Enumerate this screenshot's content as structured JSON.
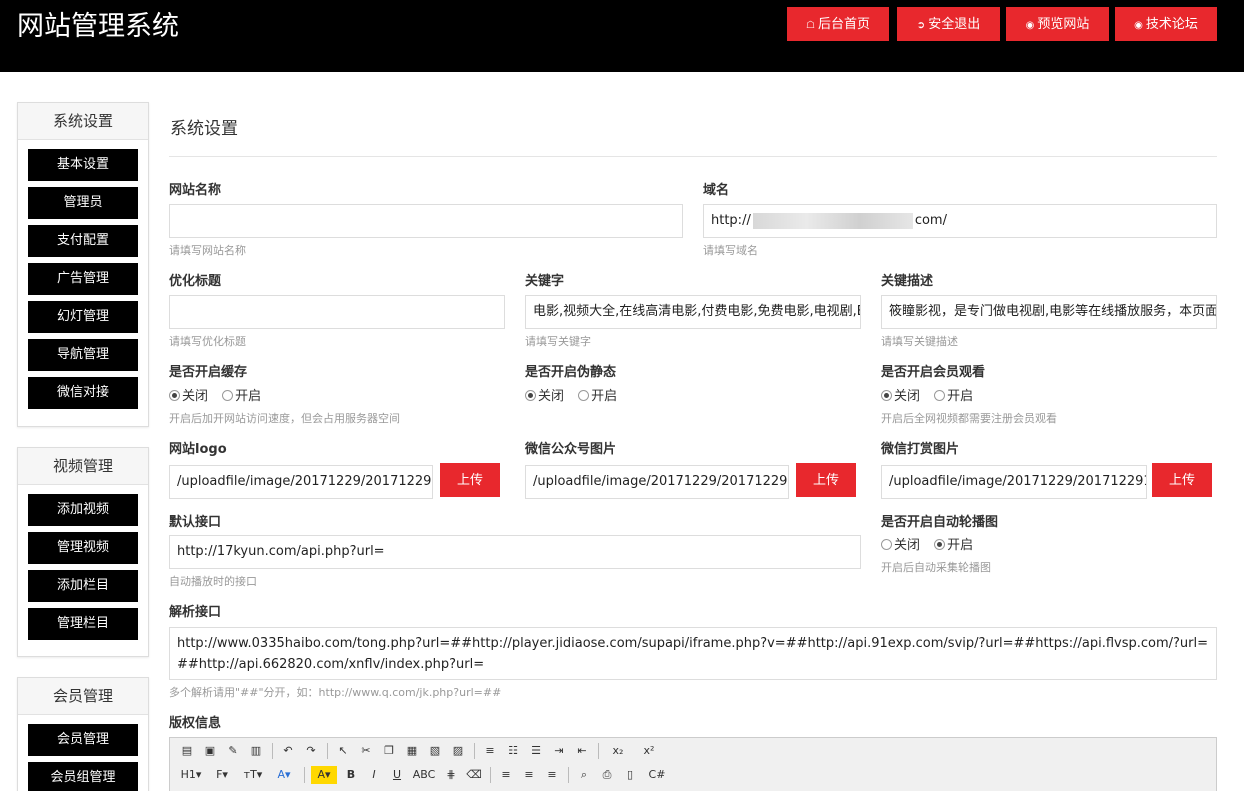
{
  "app": {
    "title": "网站管理系统"
  },
  "header": {
    "buttons": [
      {
        "label": "后台首页",
        "icon": "home-icon"
      },
      {
        "label": "安全退出",
        "icon": "logout-icon"
      },
      {
        "label": "预览网站",
        "icon": "eye-icon"
      },
      {
        "label": "技术论坛",
        "icon": "eye-icon"
      }
    ]
  },
  "sidebar": {
    "sections": [
      {
        "title": "系统设置",
        "items": [
          "基本设置",
          "管理员",
          "支付配置",
          "广告管理",
          "幻灯管理",
          "导航管理",
          "微信对接"
        ]
      },
      {
        "title": "视频管理",
        "items": [
          "添加视频",
          "管理视频",
          "添加栏目",
          "管理栏目"
        ]
      },
      {
        "title": "会员管理",
        "items": [
          "会员管理",
          "会员组管理"
        ]
      }
    ]
  },
  "main": {
    "title": "系统设置",
    "site_name": {
      "label": "网站名称",
      "value": "",
      "help": "请填写网站名称"
    },
    "domain": {
      "label": "域名",
      "prefix": "http://",
      "suffix": "com/",
      "help": "请填写域名"
    },
    "seo_title": {
      "label": "优化标题",
      "value": "",
      "help": "请填写优化标题"
    },
    "keywords": {
      "label": "关键字",
      "value": "电影,视频大全,在线高清电影,付费电影,免费电影,电视剧,E",
      "help": "请填写关键字"
    },
    "description": {
      "label": "关键描述",
      "value": "筱瞳影视，是专门做电视剧,电影等在线播放服务，本页面",
      "help": "请填写关键描述"
    },
    "cache": {
      "label": "是否开启缓存",
      "options": [
        "关闭",
        "开启"
      ],
      "selected": "关闭",
      "help": "开启后加开网站访问速度，但会占用服务器空间"
    },
    "rewrite": {
      "label": "是否开启伪静态",
      "options": [
        "关闭",
        "开启"
      ],
      "selected": "关闭"
    },
    "member_view": {
      "label": "是否开启会员观看",
      "options": [
        "关闭",
        "开启"
      ],
      "selected": "关闭",
      "help": "开启后全网视频都需要注册会员观看"
    },
    "logo": {
      "label": "网站logo",
      "value": "/uploadfile/image/20171229/201712291",
      "button": "上传"
    },
    "wechat_qr": {
      "label": "微信公众号图片",
      "value": "/uploadfile/image/20171229/201712291",
      "button": "上传"
    },
    "wechat_reward": {
      "label": "微信打赏图片",
      "value": "/uploadfile/image/20171229/201712291",
      "button": "上传"
    },
    "default_api": {
      "label": "默认接口",
      "value": "http://17kyun.com/api.php?url=",
      "help": "自动播放时的接口"
    },
    "carousel": {
      "label": "是否开启自动轮播图",
      "options": [
        "关闭",
        "开启"
      ],
      "selected": "开启",
      "help": "开启后自动采集轮播图"
    },
    "parse_api": {
      "label": "解析接口",
      "value": "http://www.0335haibo.com/tong.php?url=##http://player.jidiaose.com/supapi/iframe.php?v=##http://api.91exp.com/svip/?url=##https://api.flvsp.com/?url=##http://api.662820.com/xnflv/index.php?url=",
      "help": "多个解析请用\"##\"分开，如：http://www.q.com/jk.php?url=##"
    },
    "copyright": {
      "label": "版权信息"
    }
  },
  "editor": {
    "row1_icons": [
      "source-icon",
      "preview-icon",
      "template-icon",
      "paste-icon",
      "undo-icon",
      "redo-icon",
      "select-icon",
      "cut-icon",
      "copy-icon",
      "paste-plain-icon",
      "paste-word-icon",
      "paste-text-icon",
      "justify-icon",
      "ordered-list-icon",
      "unordered-list-icon",
      "indent-icon",
      "outdent-icon",
      "subscript-icon",
      "superscript-icon"
    ],
    "row2_icons": [
      "heading-icon",
      "font-family-icon",
      "font-size-icon",
      "font-color-icon",
      "highlight-icon",
      "bold-icon",
      "italic-icon",
      "underline-icon",
      "strikethrough-icon",
      "line-height-icon",
      "remove-format-icon",
      "align-left-icon",
      "align-center-icon",
      "align-right-icon",
      "find-icon",
      "print-icon",
      "fullscreen-icon",
      "code-icon"
    ]
  },
  "colors": {
    "accent": "#e8282d",
    "header_bg": "#000000",
    "nav_item_bg": "#000000"
  }
}
